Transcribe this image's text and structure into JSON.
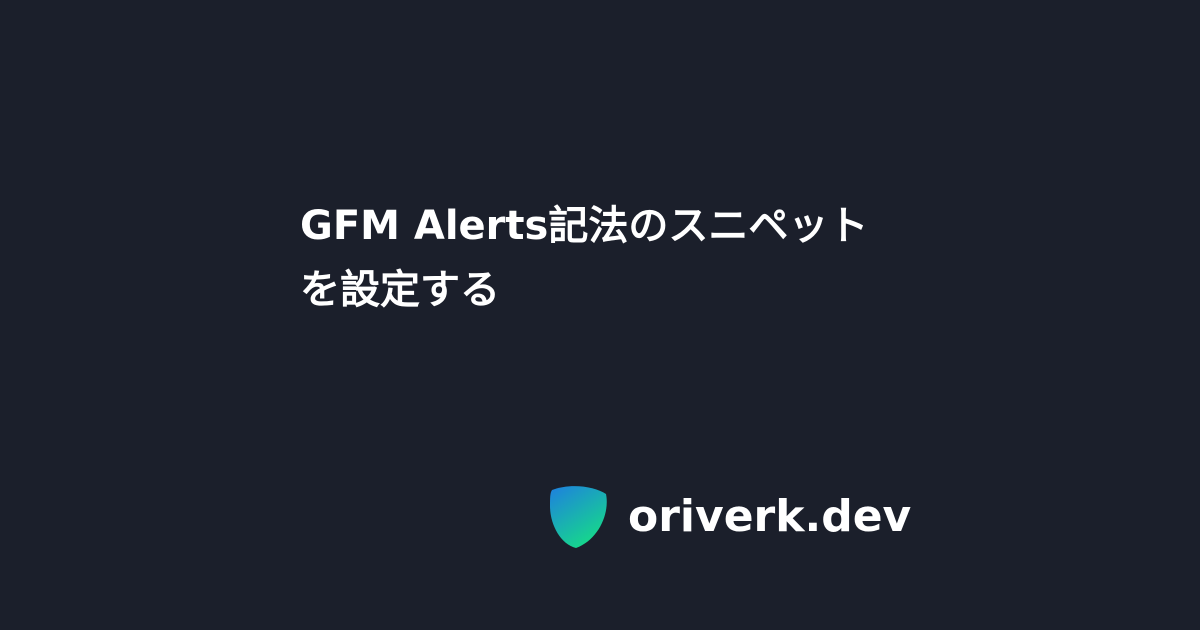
{
  "page": {
    "background_color": "#1b1f2b"
  },
  "article": {
    "title": "GFM Alerts記法のスニペットを設定する"
  },
  "brand": {
    "name": "oriverk.dev",
    "logo_icon": "gradient-shield-logo-icon",
    "logo_colors": [
      "#1e7fe0",
      "#16d98a"
    ]
  }
}
